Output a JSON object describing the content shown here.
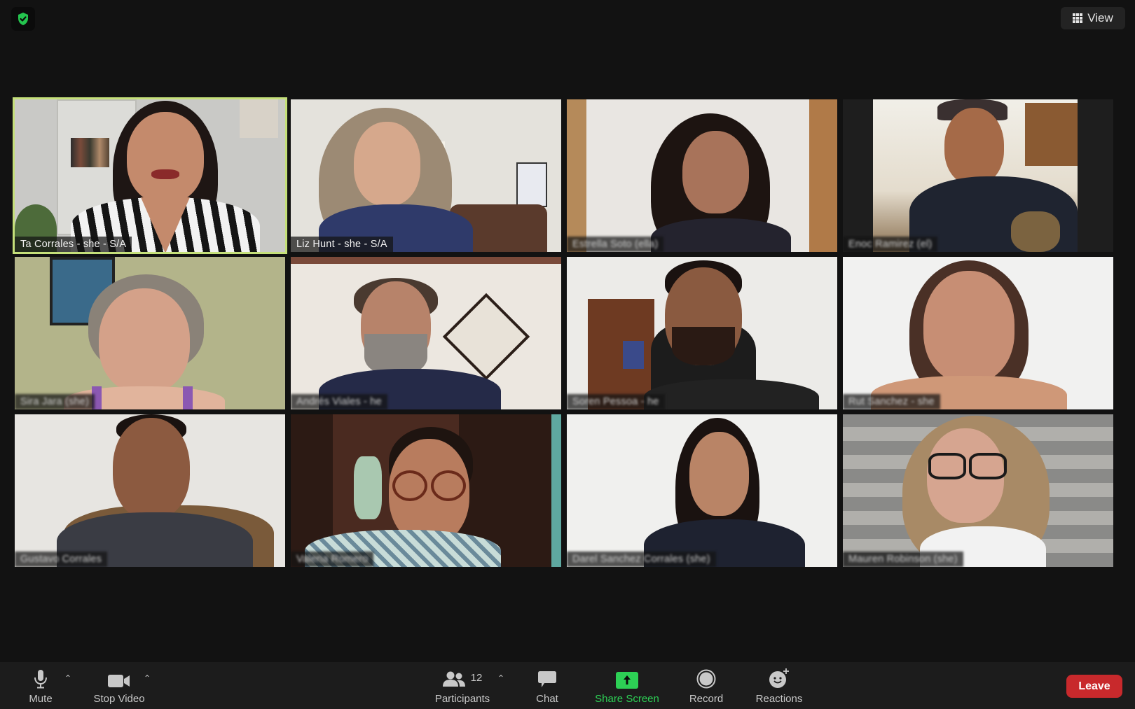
{
  "top_bar": {
    "security_icon": "shield-check-icon",
    "view_button": {
      "icon": "grid-icon",
      "label": "View"
    }
  },
  "colors": {
    "active_speaker_border": "#c5e07a",
    "share_screen_green": "#2dd055",
    "leave_red": "#c8292c",
    "shield_green": "#24c44e"
  },
  "participants": [
    {
      "name": "Ta Corrales - she - S/A",
      "active_speaker": true
    },
    {
      "name": "Liz Hunt - she - S/A",
      "active_speaker": false
    },
    {
      "name": "Estrella Soto (ella)",
      "active_speaker": false
    },
    {
      "name": "Enoc Ramirez (el)",
      "active_speaker": false
    },
    {
      "name": "Sira Jara (she)",
      "active_speaker": false
    },
    {
      "name": "Andrés Viales - he",
      "active_speaker": false
    },
    {
      "name": "Soren Pessoa - he",
      "active_speaker": false
    },
    {
      "name": "Rut Sanchez - she",
      "active_speaker": false
    },
    {
      "name": "Gustavo Corrales",
      "active_speaker": false
    },
    {
      "name": "Valeria Romero",
      "active_speaker": false
    },
    {
      "name": "Darel Sanchez Corrales (she)",
      "active_speaker": false
    },
    {
      "name": "Mauren Robinson (she)",
      "active_speaker": false
    }
  ],
  "toolbar": {
    "mute": {
      "label": "Mute",
      "icon": "microphone-icon"
    },
    "stop_video": {
      "label": "Stop Video",
      "icon": "video-camera-icon"
    },
    "participants": {
      "label": "Participants",
      "icon": "people-icon",
      "count": "12"
    },
    "chat": {
      "label": "Chat",
      "icon": "chat-bubble-icon"
    },
    "share_screen": {
      "label": "Share Screen",
      "icon": "share-arrow-icon"
    },
    "record": {
      "label": "Record",
      "icon": "record-icon"
    },
    "reactions": {
      "label": "Reactions",
      "icon": "smiley-plus-icon"
    },
    "leave": {
      "label": "Leave"
    }
  }
}
